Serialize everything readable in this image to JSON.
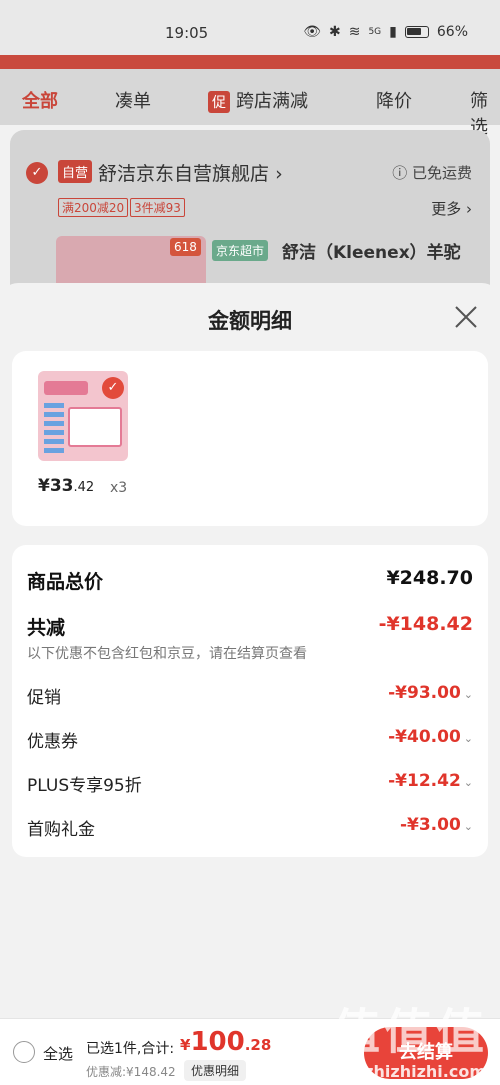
{
  "status_bar": {
    "time": "19:05",
    "network": "5G",
    "battery": "66%"
  },
  "tabs": [
    {
      "label": "全部",
      "active": true
    },
    {
      "label": "凑单"
    },
    {
      "label": "跨店满减",
      "badge": "促"
    },
    {
      "label": "降价"
    },
    {
      "label": "筛选"
    }
  ],
  "shop": {
    "tag": "自营",
    "name": "舒洁京东自营旗舰店",
    "free_shipping": "已免运费",
    "coupons": [
      "满200减20",
      "3件减93"
    ],
    "more": "更多",
    "product_tag": "618",
    "market_tag": "京东超市",
    "product_title": "舒洁（Kleenex）羊驼"
  },
  "sheet": {
    "title": "金额明细",
    "item": {
      "price_int": "¥33",
      "price_dec": ".42",
      "qty": "x3"
    },
    "total_label": "商品总价",
    "total_value": "¥248.70",
    "reduce_label": "共减",
    "reduce_value": "-¥148.42",
    "note": "以下优惠不包含红包和京豆，请在结算页查看",
    "breakdown": [
      {
        "label": "促销",
        "value": "-¥93.00"
      },
      {
        "label": "优惠券",
        "value": "-¥40.00"
      },
      {
        "label": "PLUS专享95折",
        "value": "-¥12.42"
      },
      {
        "label": "首购礼金",
        "value": "-¥3.00"
      }
    ]
  },
  "bottom": {
    "select_all": "全选",
    "selected_text": "已选1件,合计:",
    "total_sym": "¥",
    "total_int": "100",
    "total_dec": ".28",
    "discount_text": "优惠减:¥148.42",
    "detail_button": "优惠明细",
    "checkout": "去结算"
  },
  "watermark": {
    "main": "值值值",
    "sub": "zhizhizhi.com"
  },
  "colors": {
    "accent": "#e0352b",
    "brand": "#c9463a"
  }
}
